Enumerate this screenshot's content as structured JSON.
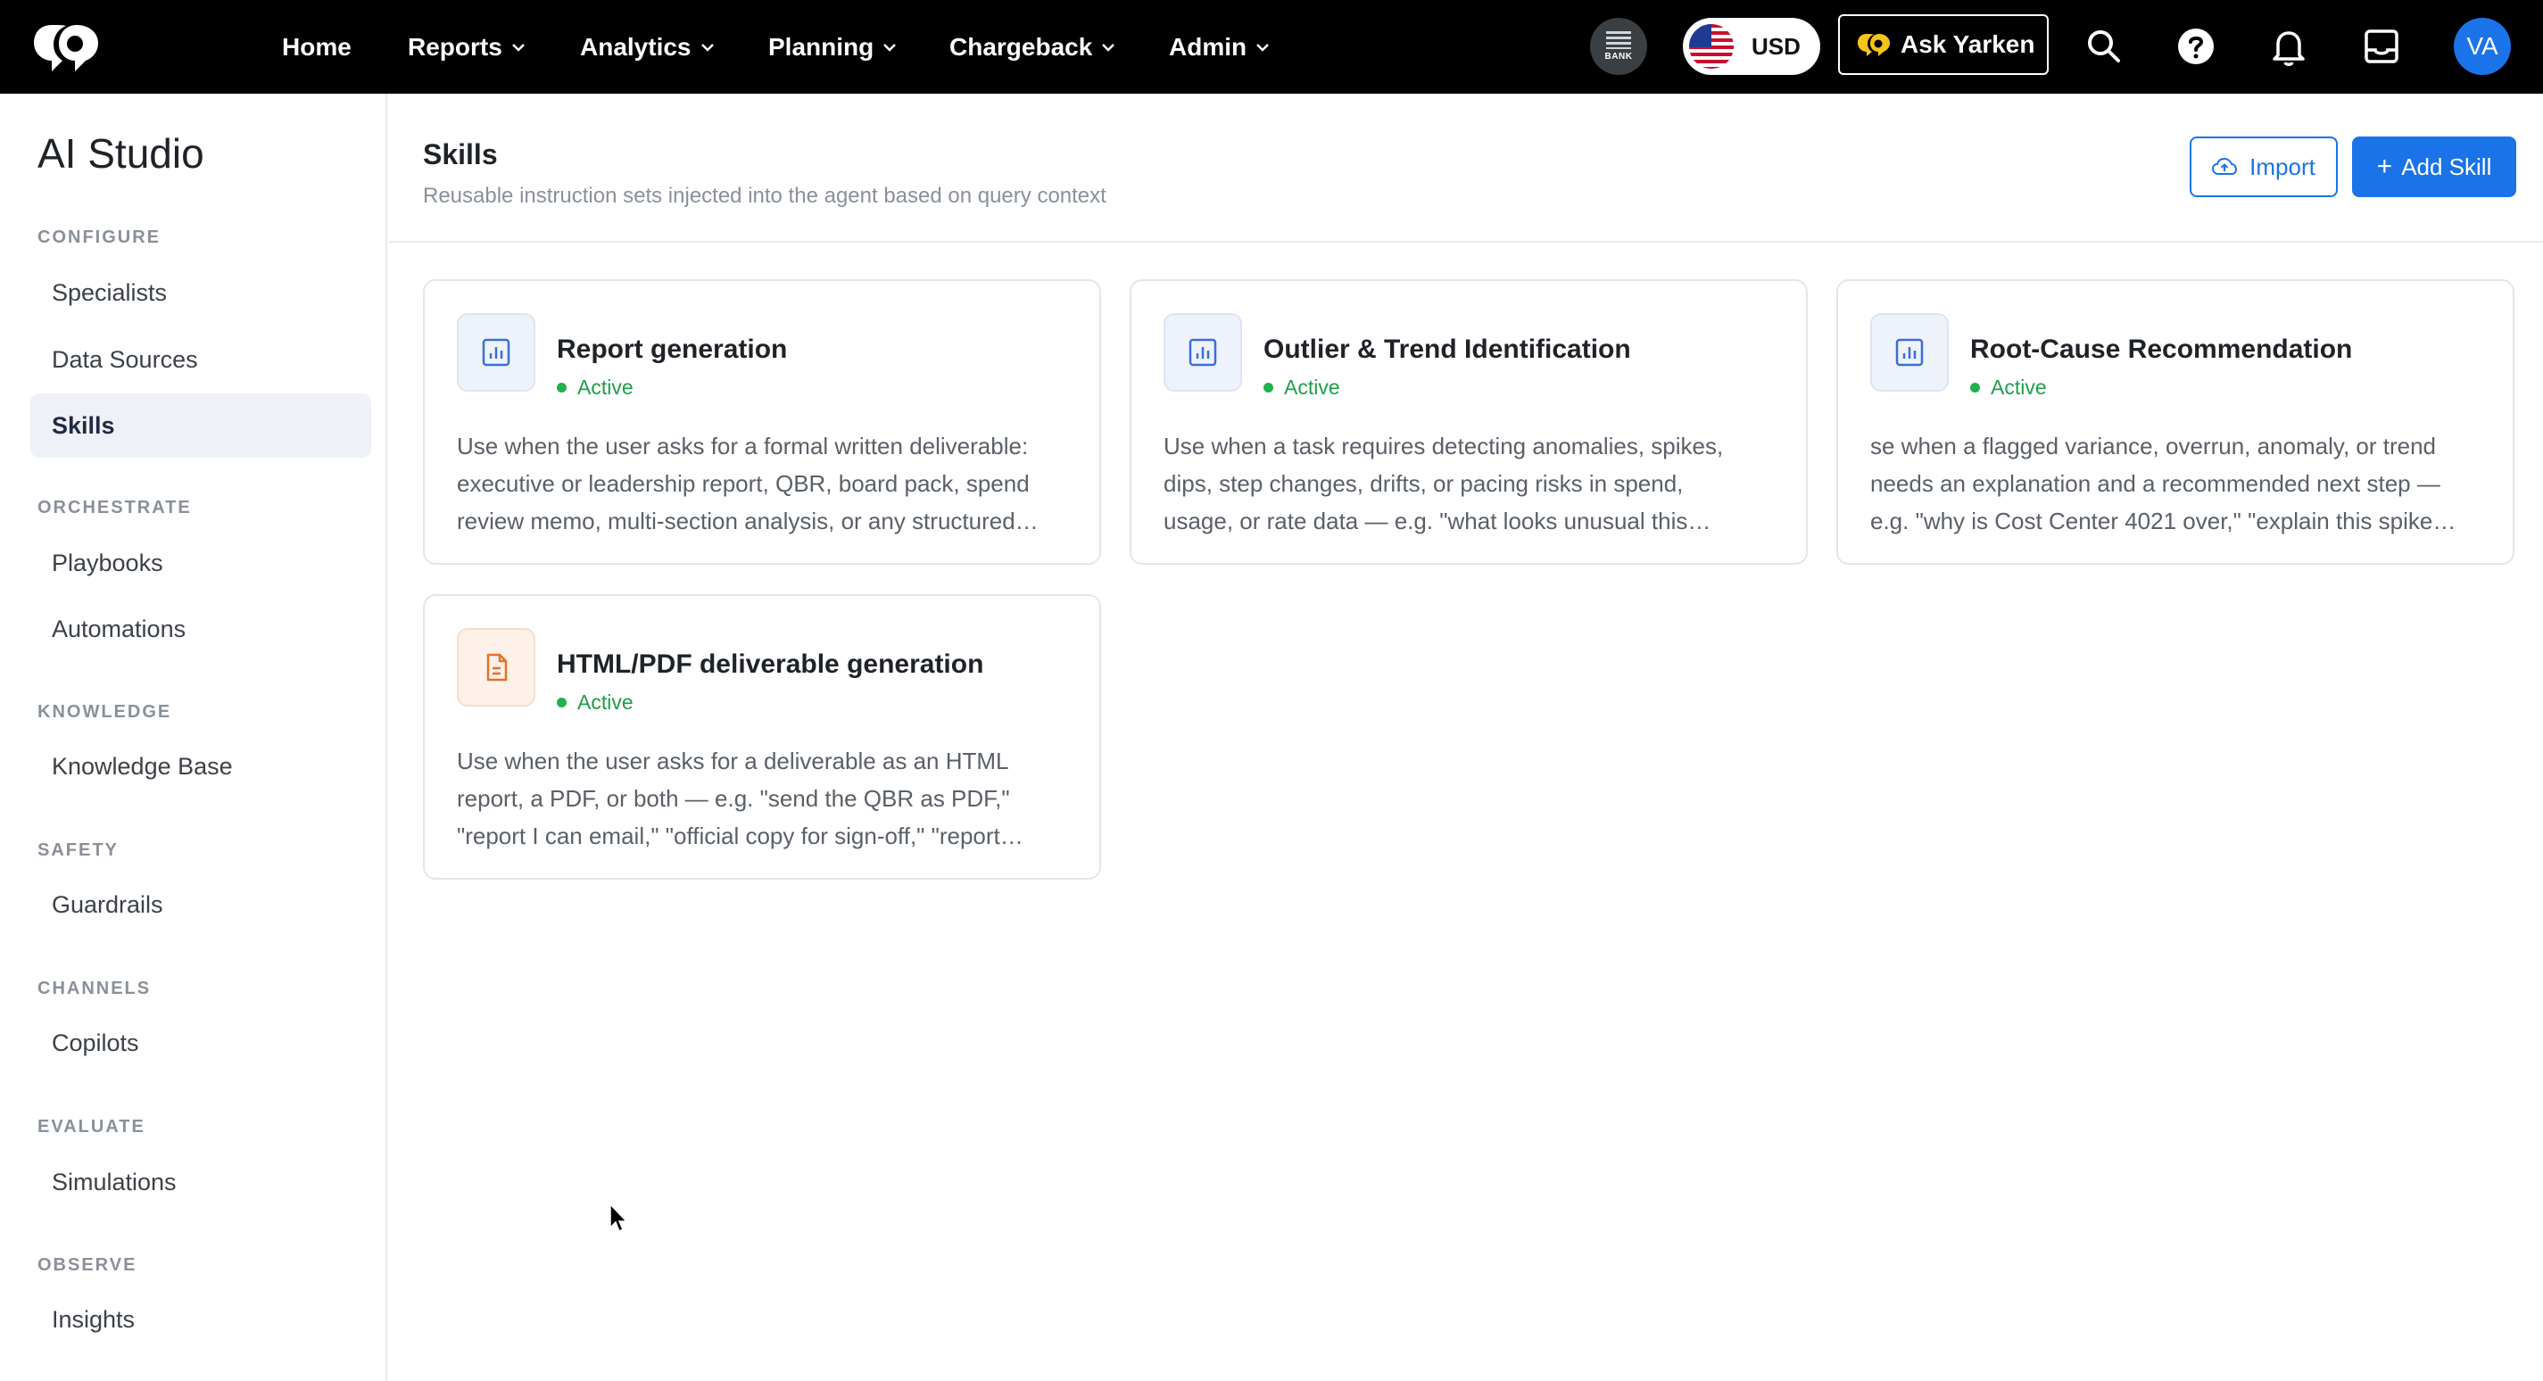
{
  "topbar": {
    "nav": [
      {
        "label": "Home",
        "has_dropdown": false
      },
      {
        "label": "Reports",
        "has_dropdown": true
      },
      {
        "label": "Analytics",
        "has_dropdown": true
      },
      {
        "label": "Planning",
        "has_dropdown": true
      },
      {
        "label": "Chargeback",
        "has_dropdown": true
      },
      {
        "label": "Admin",
        "has_dropdown": true
      }
    ],
    "bank_label": "BANK",
    "currency": "USD",
    "ask_label": "Ask Yarken",
    "icons": [
      "search-icon",
      "help-icon",
      "bell-icon",
      "inbox-icon"
    ],
    "avatar_initials": "VA"
  },
  "sidebar": {
    "title": "AI Studio",
    "sections": [
      {
        "title": "CONFIGURE",
        "items": [
          "Specialists",
          "Data Sources",
          "Skills"
        ]
      },
      {
        "title": "ORCHESTRATE",
        "items": [
          "Playbooks",
          "Automations"
        ]
      },
      {
        "title": "KNOWLEDGE",
        "items": [
          "Knowledge Base"
        ]
      },
      {
        "title": "SAFETY",
        "items": [
          "Guardrails"
        ]
      },
      {
        "title": "CHANNELS",
        "items": [
          "Copilots"
        ]
      },
      {
        "title": "EVALUATE",
        "items": [
          "Simulations"
        ]
      },
      {
        "title": "OBSERVE",
        "items": [
          "Insights"
        ]
      }
    ],
    "active_item": "Skills"
  },
  "main": {
    "title": "Skills",
    "subtitle": "Reusable instruction sets injected into the agent based on query context",
    "import_label": "Import",
    "add_label": "Add Skill",
    "cards": [
      {
        "title": "Report generation",
        "status": "Active",
        "icon": "chart-icon",
        "desc": [
          "Use when the user asks for a formal written deliverable:",
          "executive or leadership report, QBR, board pack, spend",
          "review memo, multi-section analysis, or any structured…"
        ]
      },
      {
        "title": "Outlier & Trend Identification",
        "status": "Active",
        "icon": "chart-icon",
        "desc": [
          "Use when a task requires detecting anomalies, spikes,",
          "dips, step changes, drifts, or pacing risks in spend,",
          "usage, or rate data — e.g. \"what looks unusual this…"
        ]
      },
      {
        "title": "Root-Cause Recommendation",
        "status": "Active",
        "icon": "chart-icon",
        "desc": [
          "se when a flagged variance, overrun, anomaly, or trend",
          "needs an explanation and a recommended next step —",
          "e.g. \"why is Cost Center 4021 over,\" \"explain this spike…"
        ]
      },
      {
        "title": "HTML/PDF deliverable generation",
        "status": "Active",
        "icon": "document-icon",
        "desc": [
          "Use when the user asks for a deliverable as an HTML",
          "report, a PDF, or both — e.g. \"send the QBR as PDF,\"",
          "\"report I can email,\" \"official copy for sign-off,\" \"report…"
        ]
      }
    ]
  },
  "colors": {
    "accent": "#1a73e8",
    "topbar_bg": "#000000",
    "status_active": "#1e9e4a",
    "doc_icon": "#e8702a"
  }
}
